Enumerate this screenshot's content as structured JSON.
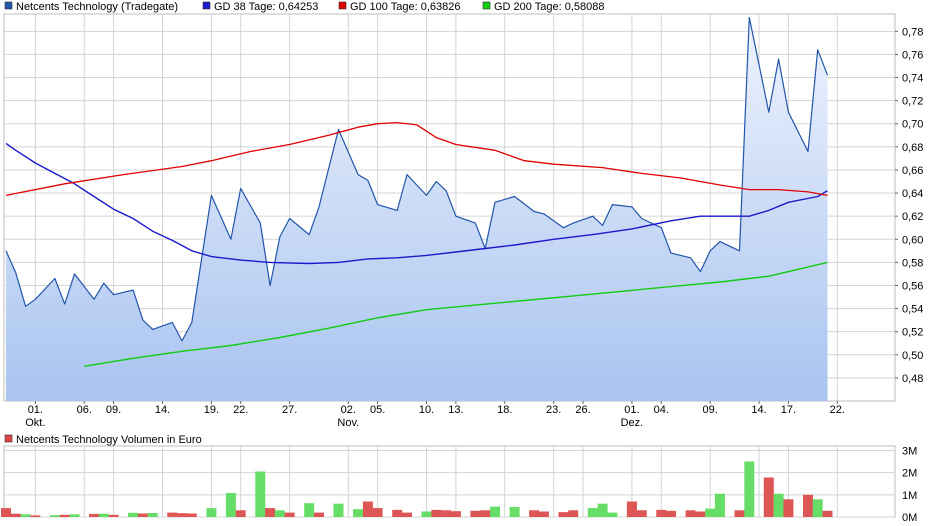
{
  "price_chart": {
    "legend": [
      {
        "label": "Netcents Technology (Tradegate)",
        "color": "#2255aa"
      },
      {
        "label": "GD 38 Tage: 0,64253",
        "color": "#1a1acc"
      },
      {
        "label": "GD 100 Tage: 0,63826",
        "color": "#e00000"
      },
      {
        "label": "GD 200 Tage: 0,58088",
        "color": "#11cc11"
      }
    ],
    "y_ticks": [
      "0,48",
      "0,50",
      "0,52",
      "0,54",
      "0,56",
      "0,58",
      "0,60",
      "0,62",
      "0,64",
      "0,66",
      "0,68",
      "0,70",
      "0,72",
      "0,74",
      "0,76",
      "0,78"
    ],
    "x_ticks": [
      "01.",
      "06.",
      "09.",
      "14.",
      "19.",
      "22.",
      "27.",
      "02.",
      "05.",
      "10.",
      "13.",
      "18.",
      "23.",
      "26.",
      "01.",
      "04.",
      "09.",
      "14.",
      "17.",
      "22."
    ],
    "month_labels": [
      "Okt.",
      "Nov.",
      "Dez."
    ]
  },
  "volume_chart": {
    "legend": {
      "label": "Netcents Technology Volumen in Euro",
      "color": "#dd4444"
    },
    "y_ticks": [
      "0M",
      "1M",
      "2M",
      "3M"
    ]
  },
  "colors": {
    "price_line": "#2255aa",
    "area_top": "#eef3fd",
    "area_bottom": "#a9c4f0",
    "gd38": "#1a1acc",
    "gd100": "#e00000",
    "gd200": "#11cc11",
    "vol_up": "#66dd66",
    "vol_down": "#dd5555",
    "grid": "#d4d4d4"
  },
  "chart_data": [
    {
      "type": "line",
      "title": "",
      "ylim": [
        0.46,
        0.795
      ],
      "x_range": [
        "2018-09-28",
        "2018-12-24"
      ],
      "grid": true,
      "legend_position": "top-left",
      "series": [
        {
          "name": "Netcents Technology (Tradegate)",
          "points": [
            [
              "2018-09-28",
              0.59
            ],
            [
              "2018-09-29",
              0.571
            ],
            [
              "2018-09-30",
              0.542
            ],
            [
              "2018-10-01",
              0.548
            ],
            [
              "2018-10-03",
              0.566
            ],
            [
              "2018-10-04",
              0.544
            ],
            [
              "2018-10-05",
              0.57
            ],
            [
              "2018-10-07",
              0.548
            ],
            [
              "2018-10-08",
              0.562
            ],
            [
              "2018-10-09",
              0.552
            ],
            [
              "2018-10-11",
              0.556
            ],
            [
              "2018-10-12",
              0.53
            ],
            [
              "2018-10-13",
              0.522
            ],
            [
              "2018-10-15",
              0.528
            ],
            [
              "2018-10-16",
              0.512
            ],
            [
              "2018-10-17",
              0.528
            ],
            [
              "2018-10-19",
              0.638
            ],
            [
              "2018-10-21",
              0.6
            ],
            [
              "2018-10-22",
              0.644
            ],
            [
              "2018-10-24",
              0.614
            ],
            [
              "2018-10-25",
              0.56
            ],
            [
              "2018-10-26",
              0.602
            ],
            [
              "2018-10-27",
              0.618
            ],
            [
              "2018-10-29",
              0.604
            ],
            [
              "2018-10-30",
              0.628
            ],
            [
              "2018-11-01",
              0.695
            ],
            [
              "2018-11-03",
              0.656
            ],
            [
              "2018-11-04",
              0.651
            ],
            [
              "2018-11-05",
              0.63
            ],
            [
              "2018-11-07",
              0.625
            ],
            [
              "2018-11-08",
              0.656
            ],
            [
              "2018-11-10",
              0.638
            ],
            [
              "2018-11-11",
              0.65
            ],
            [
              "2018-11-12",
              0.642
            ],
            [
              "2018-11-13",
              0.62
            ],
            [
              "2018-11-15",
              0.614
            ],
            [
              "2018-11-16",
              0.592
            ],
            [
              "2018-11-17",
              0.632
            ],
            [
              "2018-11-19",
              0.637
            ],
            [
              "2018-11-21",
              0.624
            ],
            [
              "2018-11-22",
              0.622
            ],
            [
              "2018-11-24",
              0.61
            ],
            [
              "2018-11-25",
              0.614
            ],
            [
              "2018-11-27",
              0.62
            ],
            [
              "2018-11-28",
              0.612
            ],
            [
              "2018-11-29",
              0.63
            ],
            [
              "2018-12-01",
              0.628
            ],
            [
              "2018-12-02",
              0.618
            ],
            [
              "2018-12-04",
              0.61
            ],
            [
              "2018-12-05",
              0.588
            ],
            [
              "2018-12-07",
              0.584
            ],
            [
              "2018-12-08",
              0.572
            ],
            [
              "2018-12-09",
              0.59
            ],
            [
              "2018-12-10",
              0.598
            ],
            [
              "2018-12-12",
              0.59
            ],
            [
              "2018-12-13",
              0.792
            ],
            [
              "2018-12-15",
              0.71
            ],
            [
              "2018-12-16",
              0.756
            ],
            [
              "2018-12-17",
              0.71
            ],
            [
              "2018-12-19",
              0.676
            ],
            [
              "2018-12-20",
              0.764
            ],
            [
              "2018-12-21",
              0.742
            ]
          ]
        },
        {
          "name": "GD 38 Tage: 0,64253",
          "points": [
            [
              "2018-09-28",
              0.683
            ],
            [
              "2018-09-29",
              0.677
            ],
            [
              "2018-10-01",
              0.666
            ],
            [
              "2018-10-03",
              0.657
            ],
            [
              "2018-10-05",
              0.648
            ],
            [
              "2018-10-07",
              0.637
            ],
            [
              "2018-10-09",
              0.626
            ],
            [
              "2018-10-11",
              0.618
            ],
            [
              "2018-10-13",
              0.607
            ],
            [
              "2018-10-15",
              0.599
            ],
            [
              "2018-10-17",
              0.59
            ],
            [
              "2018-10-19",
              0.585
            ],
            [
              "2018-10-22",
              0.582
            ],
            [
              "2018-10-25",
              0.58
            ],
            [
              "2018-10-29",
              0.579
            ],
            [
              "2018-11-01",
              0.58
            ],
            [
              "2018-11-04",
              0.583
            ],
            [
              "2018-11-07",
              0.584
            ],
            [
              "2018-11-10",
              0.586
            ],
            [
              "2018-11-13",
              0.589
            ],
            [
              "2018-11-16",
              0.592
            ],
            [
              "2018-11-19",
              0.595
            ],
            [
              "2018-11-23",
              0.6
            ],
            [
              "2018-11-27",
              0.604
            ],
            [
              "2018-12-01",
              0.609
            ],
            [
              "2018-12-05",
              0.616
            ],
            [
              "2018-12-08",
              0.62
            ],
            [
              "2018-12-11",
              0.62
            ],
            [
              "2018-12-13",
              0.62
            ],
            [
              "2018-12-15",
              0.625
            ],
            [
              "2018-12-17",
              0.632
            ],
            [
              "2018-12-20",
              0.637
            ],
            [
              "2018-12-21",
              0.642
            ]
          ]
        },
        {
          "name": "GD 100 Tage: 0,63826",
          "points": [
            [
              "2018-09-28",
              0.638
            ],
            [
              "2018-10-04",
              0.648
            ],
            [
              "2018-10-10",
              0.656
            ],
            [
              "2018-10-16",
              0.663
            ],
            [
              "2018-10-19",
              0.668
            ],
            [
              "2018-10-23",
              0.676
            ],
            [
              "2018-10-27",
              0.682
            ],
            [
              "2018-10-31",
              0.69
            ],
            [
              "2018-11-03",
              0.697
            ],
            [
              "2018-11-05",
              0.7
            ],
            [
              "2018-11-07",
              0.701
            ],
            [
              "2018-11-09",
              0.699
            ],
            [
              "2018-11-11",
              0.688
            ],
            [
              "2018-11-13",
              0.682
            ],
            [
              "2018-11-17",
              0.677
            ],
            [
              "2018-11-20",
              0.668
            ],
            [
              "2018-11-23",
              0.665
            ],
            [
              "2018-11-28",
              0.662
            ],
            [
              "2018-12-02",
              0.657
            ],
            [
              "2018-12-06",
              0.653
            ],
            [
              "2018-12-10",
              0.647
            ],
            [
              "2018-12-13",
              0.643
            ],
            [
              "2018-12-16",
              0.643
            ],
            [
              "2018-12-19",
              0.641
            ],
            [
              "2018-12-21",
              0.638
            ]
          ]
        },
        {
          "name": "GD 200 Tage: 0,58088",
          "points": [
            [
              "2018-10-06",
              0.49
            ],
            [
              "2018-10-11",
              0.497
            ],
            [
              "2018-10-16",
              0.503
            ],
            [
              "2018-10-21",
              0.508
            ],
            [
              "2018-10-26",
              0.515
            ],
            [
              "2018-10-31",
              0.523
            ],
            [
              "2018-11-05",
              0.532
            ],
            [
              "2018-11-10",
              0.539
            ],
            [
              "2018-11-15",
              0.543
            ],
            [
              "2018-11-20",
              0.547
            ],
            [
              "2018-11-25",
              0.551
            ],
            [
              "2018-11-30",
              0.555
            ],
            [
              "2018-12-05",
              0.559
            ],
            [
              "2018-12-10",
              0.563
            ],
            [
              "2018-12-15",
              0.568
            ],
            [
              "2018-12-21",
              0.58
            ]
          ]
        }
      ]
    },
    {
      "type": "bar",
      "title": "",
      "ylim": [
        0,
        3200000
      ],
      "ylabel_unit": "Euro",
      "series": [
        {
          "name": "Netcents Technology Volumen in Euro",
          "bars": [
            [
              "2018-09-28",
              400000,
              "down"
            ],
            [
              "2018-09-29",
              150000,
              "down"
            ],
            [
              "2018-09-30",
              120000,
              "up"
            ],
            [
              "2018-10-01",
              70000,
              "down"
            ],
            [
              "2018-10-03",
              80000,
              "up"
            ],
            [
              "2018-10-04",
              100000,
              "down"
            ],
            [
              "2018-10-05",
              120000,
              "up"
            ],
            [
              "2018-10-07",
              140000,
              "down"
            ],
            [
              "2018-10-08",
              150000,
              "up"
            ],
            [
              "2018-10-09",
              100000,
              "down"
            ],
            [
              "2018-10-11",
              190000,
              "up"
            ],
            [
              "2018-10-12",
              160000,
              "down"
            ],
            [
              "2018-10-13",
              180000,
              "up"
            ],
            [
              "2018-10-15",
              200000,
              "down"
            ],
            [
              "2018-10-16",
              170000,
              "down"
            ],
            [
              "2018-10-17",
              160000,
              "down"
            ],
            [
              "2018-10-19",
              400000,
              "up"
            ],
            [
              "2018-10-21",
              1080000,
              "up"
            ],
            [
              "2018-10-22",
              300000,
              "down"
            ],
            [
              "2018-10-24",
              2050000,
              "up"
            ],
            [
              "2018-10-25",
              400000,
              "down"
            ],
            [
              "2018-10-26",
              300000,
              "up"
            ],
            [
              "2018-10-27",
              200000,
              "down"
            ],
            [
              "2018-10-29",
              620000,
              "up"
            ],
            [
              "2018-10-30",
              200000,
              "down"
            ],
            [
              "2018-11-01",
              600000,
              "up"
            ],
            [
              "2018-11-03",
              350000,
              "up"
            ],
            [
              "2018-11-04",
              700000,
              "down"
            ],
            [
              "2018-11-05",
              400000,
              "down"
            ],
            [
              "2018-11-07",
              320000,
              "down"
            ],
            [
              "2018-11-08",
              200000,
              "down"
            ],
            [
              "2018-11-10",
              250000,
              "up"
            ],
            [
              "2018-11-11",
              320000,
              "down"
            ],
            [
              "2018-11-12",
              300000,
              "down"
            ],
            [
              "2018-11-13",
              260000,
              "down"
            ],
            [
              "2018-11-15",
              280000,
              "down"
            ],
            [
              "2018-11-16",
              300000,
              "down"
            ],
            [
              "2018-11-17",
              470000,
              "up"
            ],
            [
              "2018-11-19",
              450000,
              "up"
            ],
            [
              "2018-11-21",
              300000,
              "down"
            ],
            [
              "2018-11-22",
              250000,
              "down"
            ],
            [
              "2018-11-24",
              220000,
              "down"
            ],
            [
              "2018-11-25",
              300000,
              "down"
            ],
            [
              "2018-11-27",
              400000,
              "up"
            ],
            [
              "2018-11-28",
              600000,
              "up"
            ],
            [
              "2018-11-29",
              200000,
              "up"
            ],
            [
              "2018-12-01",
              700000,
              "down"
            ],
            [
              "2018-12-02",
              300000,
              "down"
            ],
            [
              "2018-12-04",
              320000,
              "down"
            ],
            [
              "2018-12-05",
              280000,
              "down"
            ],
            [
              "2018-12-07",
              300000,
              "down"
            ],
            [
              "2018-12-08",
              250000,
              "down"
            ],
            [
              "2018-12-09",
              380000,
              "up"
            ],
            [
              "2018-12-10",
              1050000,
              "up"
            ],
            [
              "2018-12-12",
              300000,
              "down"
            ],
            [
              "2018-12-13",
              2500000,
              "up"
            ],
            [
              "2018-12-15",
              1780000,
              "down"
            ],
            [
              "2018-12-16",
              1050000,
              "up"
            ],
            [
              "2018-12-17",
              800000,
              "down"
            ],
            [
              "2018-12-19",
              1000000,
              "down"
            ],
            [
              "2018-12-20",
              800000,
              "up"
            ],
            [
              "2018-12-21",
              280000,
              "down"
            ]
          ]
        }
      ]
    }
  ]
}
